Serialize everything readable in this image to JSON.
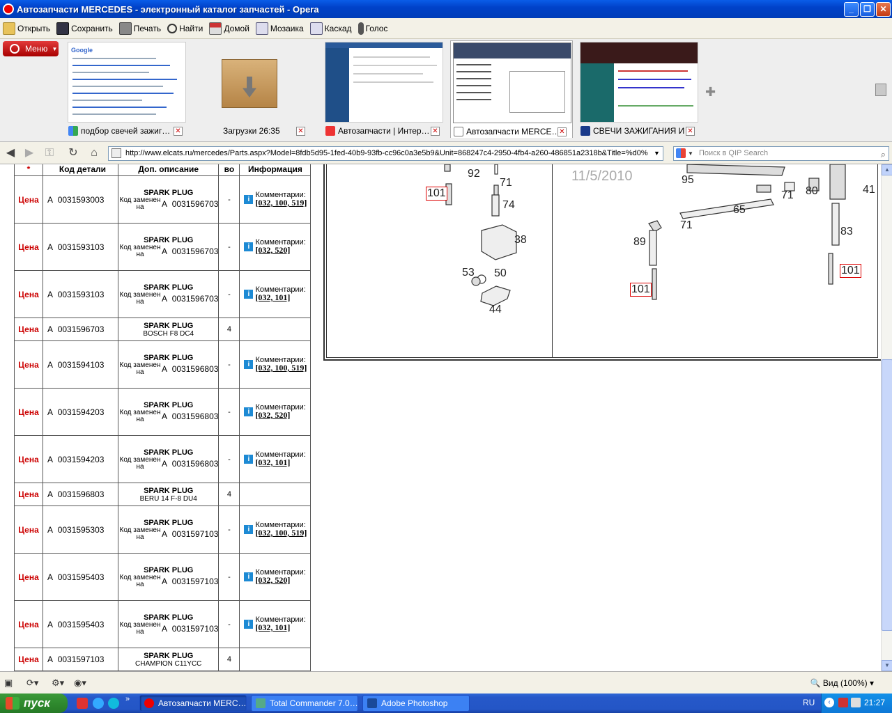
{
  "window": {
    "title": "Автозапчасти MERCEDES - электронный каталог запчастей - Opera"
  },
  "toolbar": {
    "open": "Открыть",
    "save": "Сохранить",
    "print": "Печать",
    "find": "Найти",
    "home": "Домой",
    "mosaic": "Мозаика",
    "cascade": "Каскад",
    "voice": "Голос"
  },
  "menu": {
    "label": "Меню"
  },
  "tabs": [
    {
      "label": "подбор свечей зажиг…"
    },
    {
      "label": "Загрузки 26:35"
    },
    {
      "label": "Автозапчасти | Интер…"
    },
    {
      "label": "Автозапчасти MERCE…"
    },
    {
      "label": "СВЕЧИ ЗАЖИГАНИЯ И…"
    }
  ],
  "address": {
    "url": "http://www.elcats.ru/mercedes/Parts.aspx?Model=8fdb5d95-1fed-40b9-93fb-cc96c0a3e5b9&Unit=868247c4-2950-4fb4-a260-486851a2318b&Title=%d0%",
    "search_placeholder": "Поиск в QIP Search"
  },
  "table": {
    "headers": {
      "star": "*",
      "part": "Код детали",
      "desc": "Доп. описание",
      "qty": "во",
      "info": "Информация"
    },
    "rows": [
      {
        "price": "Цена",
        "prefix": "A",
        "part": "0031593003",
        "title": "SPARK PLUG",
        "code_label": "Код заменен на",
        "repl_prefix": "A",
        "repl": "0031596703",
        "sub": "",
        "qty": "-",
        "info_label": "Комментарии:",
        "info_codes": "[032, 100, 519]"
      },
      {
        "price": "Цена",
        "prefix": "A",
        "part": "0031593103",
        "title": "SPARK PLUG",
        "code_label": "Код заменен на",
        "repl_prefix": "A",
        "repl": "0031596703",
        "sub": "",
        "qty": "-",
        "info_label": "Комментарии:",
        "info_codes": "[032, 520]"
      },
      {
        "price": "Цена",
        "prefix": "A",
        "part": "0031593103",
        "title": "SPARK PLUG",
        "code_label": "Код заменен на",
        "repl_prefix": "A",
        "repl": "0031596703",
        "sub": "",
        "qty": "-",
        "info_label": "Комментарии:",
        "info_codes": "[032, 101]"
      },
      {
        "price": "Цена",
        "prefix": "A",
        "part": "0031596703",
        "title": "SPARK PLUG",
        "code_label": "",
        "repl_prefix": "",
        "repl": "",
        "sub": "BOSCH F8 DC4",
        "qty": "4",
        "info_label": "",
        "info_codes": ""
      },
      {
        "price": "Цена",
        "prefix": "A",
        "part": "0031594103",
        "title": "SPARK PLUG",
        "code_label": "Код заменен на",
        "repl_prefix": "A",
        "repl": "0031596803",
        "sub": "",
        "qty": "-",
        "info_label": "Комментарии:",
        "info_codes": "[032, 100, 519]"
      },
      {
        "price": "Цена",
        "prefix": "A",
        "part": "0031594203",
        "title": "SPARK PLUG",
        "code_label": "Код заменен на",
        "repl_prefix": "A",
        "repl": "0031596803",
        "sub": "",
        "qty": "-",
        "info_label": "Комментарии:",
        "info_codes": "[032, 520]"
      },
      {
        "price": "Цена",
        "prefix": "A",
        "part": "0031594203",
        "title": "SPARK PLUG",
        "code_label": "Код заменен на",
        "repl_prefix": "A",
        "repl": "0031596803",
        "sub": "",
        "qty": "-",
        "info_label": "Комментарии:",
        "info_codes": "[032, 101]"
      },
      {
        "price": "Цена",
        "prefix": "A",
        "part": "0031596803",
        "title": "SPARK PLUG",
        "code_label": "",
        "repl_prefix": "",
        "repl": "",
        "sub": "BERU 14 F-8 DU4",
        "qty": "4",
        "info_label": "",
        "info_codes": ""
      },
      {
        "price": "Цена",
        "prefix": "A",
        "part": "0031595303",
        "title": "SPARK PLUG",
        "code_label": "Код заменен на",
        "repl_prefix": "A",
        "repl": "0031597103",
        "sub": "",
        "qty": "-",
        "info_label": "Комментарии:",
        "info_codes": "[032, 100, 519]"
      },
      {
        "price": "Цена",
        "prefix": "A",
        "part": "0031595403",
        "title": "SPARK PLUG",
        "code_label": "Код заменен на",
        "repl_prefix": "A",
        "repl": "0031597103",
        "sub": "",
        "qty": "-",
        "info_label": "Комментарии:",
        "info_codes": "[032, 520]"
      },
      {
        "price": "Цена",
        "prefix": "A",
        "part": "0031595403",
        "title": "SPARK PLUG",
        "code_label": "Код заменен на",
        "repl_prefix": "A",
        "repl": "0031597103",
        "sub": "",
        "qty": "-",
        "info_label": "Комментарии:",
        "info_codes": "[032, 101]"
      },
      {
        "price": "Цена",
        "prefix": "A",
        "part": "0031597103",
        "title": "SPARK PLUG",
        "code_label": "",
        "repl_prefix": "",
        "repl": "",
        "sub": "CHAMPION C11YCC",
        "qty": "4",
        "info_label": "",
        "info_codes": ""
      }
    ]
  },
  "diagram": {
    "left_labels": [
      "92",
      "71",
      "101",
      "74",
      "38",
      "53",
      "50",
      "44"
    ],
    "right_labels": [
      "95",
      "71",
      "80",
      "41",
      "65",
      "71",
      "83",
      "89",
      "101",
      "101"
    ],
    "date": "11/5/2010"
  },
  "statusbar": {
    "zoom": "Вид (100%)"
  },
  "taskbar": {
    "start": "пуск",
    "tasks": [
      "Автозапчасти MERC…",
      "Total Commander 7.0…",
      "Adobe Photoshop"
    ],
    "lang": "RU",
    "clock": "21:27"
  }
}
